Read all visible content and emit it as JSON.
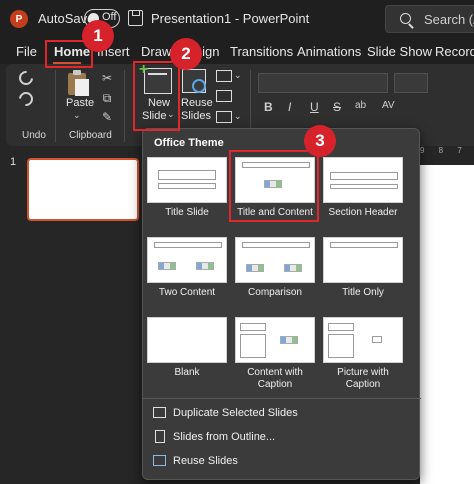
{
  "titlebar": {
    "app_logo": "P",
    "autosave_label": "AutoSave",
    "autosave_state": "Off",
    "document_title": "Presentation1  -  PowerPoint",
    "search_placeholder": "Search (A"
  },
  "tabs": [
    {
      "label": "File"
    },
    {
      "label": "Home"
    },
    {
      "label": "Insert"
    },
    {
      "label": "Draw"
    },
    {
      "label": "Design"
    },
    {
      "label": "Transitions"
    },
    {
      "label": "Animations"
    },
    {
      "label": "Slide Show"
    },
    {
      "label": "Record"
    }
  ],
  "ribbon": {
    "undo_group_label": "Undo",
    "paste_label": "Paste",
    "clipboard_group_label": "Clipboard",
    "new_slide_label_1": "New",
    "new_slide_label_2": "Slide",
    "reuse_slides_label_1": "Reuse",
    "reuse_slides_label_2": "Slides",
    "format_buttons": [
      "B",
      "I",
      "U",
      "S",
      "ab",
      "AV"
    ]
  },
  "slides_pane": {
    "slide_number": "1"
  },
  "ruler_text": "9 8 7",
  "gallery": {
    "title": "Office Theme",
    "layouts": [
      {
        "label": "Title Slide"
      },
      {
        "label": "Title and Content"
      },
      {
        "label": "Section Header"
      },
      {
        "label": "Two Content"
      },
      {
        "label": "Comparison"
      },
      {
        "label": "Title Only"
      },
      {
        "label": "Blank"
      },
      {
        "label": "Content with\nCaption"
      },
      {
        "label": "Picture with\nCaption"
      }
    ],
    "menu_items": [
      {
        "label": "Duplicate Selected Slides"
      },
      {
        "label": "Slides from Outline..."
      },
      {
        "label": "Reuse Slides"
      }
    ]
  },
  "annotations": {
    "badge_1": "1",
    "badge_2": "2",
    "badge_3": "3",
    "color": "#d6222a"
  }
}
